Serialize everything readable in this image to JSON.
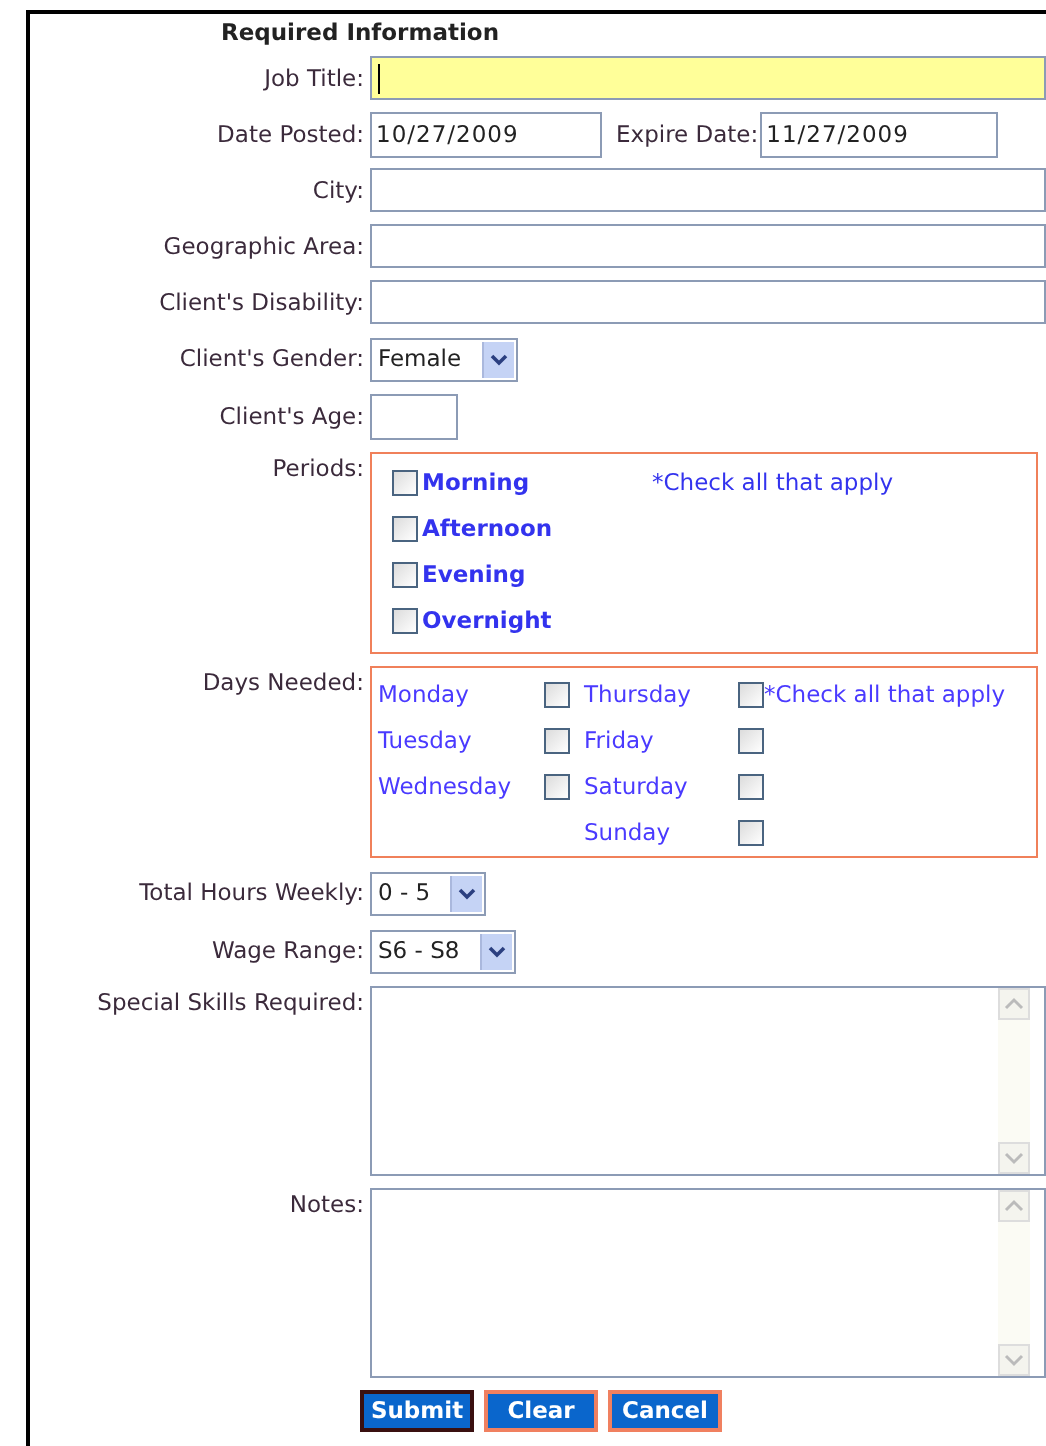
{
  "heading": "Required Information",
  "fields": [
    {
      "kind": "text",
      "label": "Job Title:",
      "focused": true
    },
    {
      "kind": "date_pair",
      "label": "Date Posted:",
      "value": "10/27/2009",
      "label_2": "Expire Date:",
      "value_2": "11/27/2009"
    },
    {
      "kind": "text",
      "label": "City:",
      "focused": false
    },
    {
      "kind": "text",
      "label": "Geographic Area:",
      "focused": false
    },
    {
      "kind": "text",
      "label": "Client's Disability:",
      "focused": false
    },
    {
      "kind": "select",
      "label": "Client's Gender:",
      "value": "Female"
    },
    {
      "kind": "short_text",
      "label": "Client's Age:"
    },
    {
      "kind": "periods",
      "label": "Periods:",
      "note": "*Check all that apply",
      "options": [
        {
          "label": "Morning",
          "checked": false
        },
        {
          "label": "Afternoon",
          "checked": false
        },
        {
          "label": "Evening",
          "checked": false
        },
        {
          "label": "Overnight",
          "checked": false
        }
      ]
    },
    {
      "kind": "days",
      "label": "Days Needed:",
      "note": "*Check all that apply",
      "columns": [
        {
          "days": [
            {
              "label": "Monday",
              "checked": false
            },
            {
              "label": "Tuesday",
              "checked": false
            },
            {
              "label": "Wednesday",
              "checked": false
            }
          ]
        },
        {
          "days": [
            {
              "label": "Thursday",
              "checked": false
            },
            {
              "label": "Friday",
              "checked": false
            },
            {
              "label": "Saturday",
              "checked": false
            },
            {
              "label": "Sunday",
              "checked": false
            }
          ]
        }
      ]
    },
    {
      "kind": "select",
      "label": "Total Hours Weekly:",
      "value": "0 - 5"
    },
    {
      "kind": "select",
      "label": "Wage Range:",
      "value": "S6 - S8"
    },
    {
      "kind": "textarea",
      "label": "Special Skills Required:"
    },
    {
      "kind": "textarea",
      "label": "Notes:"
    }
  ],
  "buttons": [
    {
      "label": "Submit",
      "focused": true
    },
    {
      "label": "Clear",
      "focused": false
    },
    {
      "label": "Cancel",
      "focused": false
    }
  ]
}
